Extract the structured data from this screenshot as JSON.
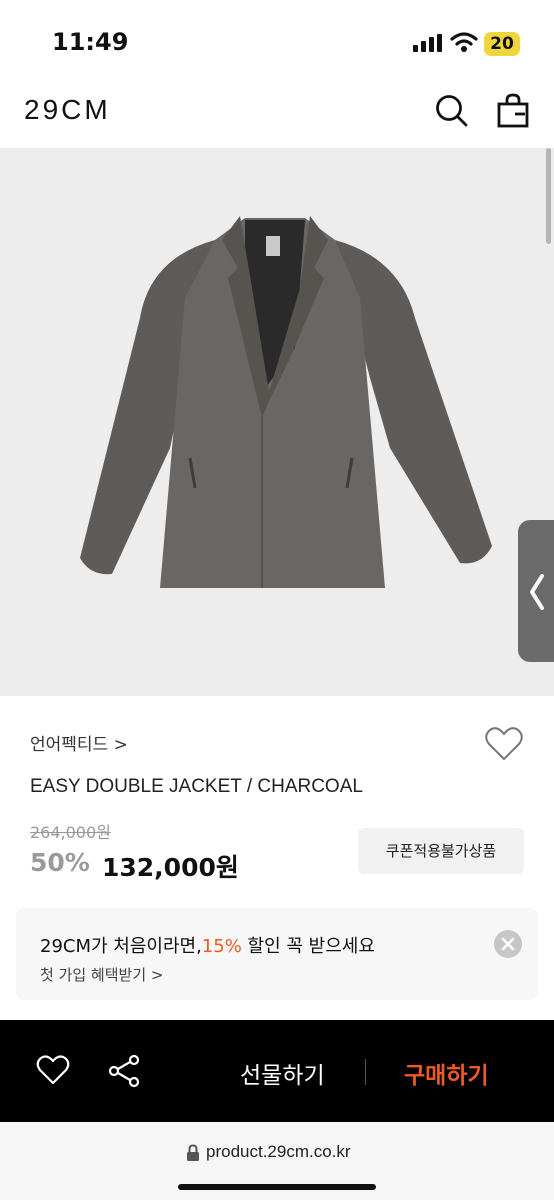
{
  "status_bar": {
    "time": "11:49",
    "battery": "20"
  },
  "header": {
    "logo": "29CM"
  },
  "product": {
    "brand": "언어펙티드 >",
    "name": "EASY DOUBLE JACKET / CHARCOAL",
    "original_price": "264,000원",
    "discount": "50%",
    "price": "132,000원",
    "coupon_label": "쿠폰적용불가상품"
  },
  "promo": {
    "title_prefix": "29CM가 처음이라면,",
    "title_accent": "15%",
    "title_suffix": " 할인 꼭 받으세요",
    "subtitle": "첫 가입 혜택받기 >"
  },
  "actions": {
    "gift_label": "선물하기",
    "buy_label": "구매하기"
  },
  "browser": {
    "url": "product.29cm.co.kr"
  },
  "colors": {
    "accent": "#f05a22",
    "bar": "#000000"
  }
}
